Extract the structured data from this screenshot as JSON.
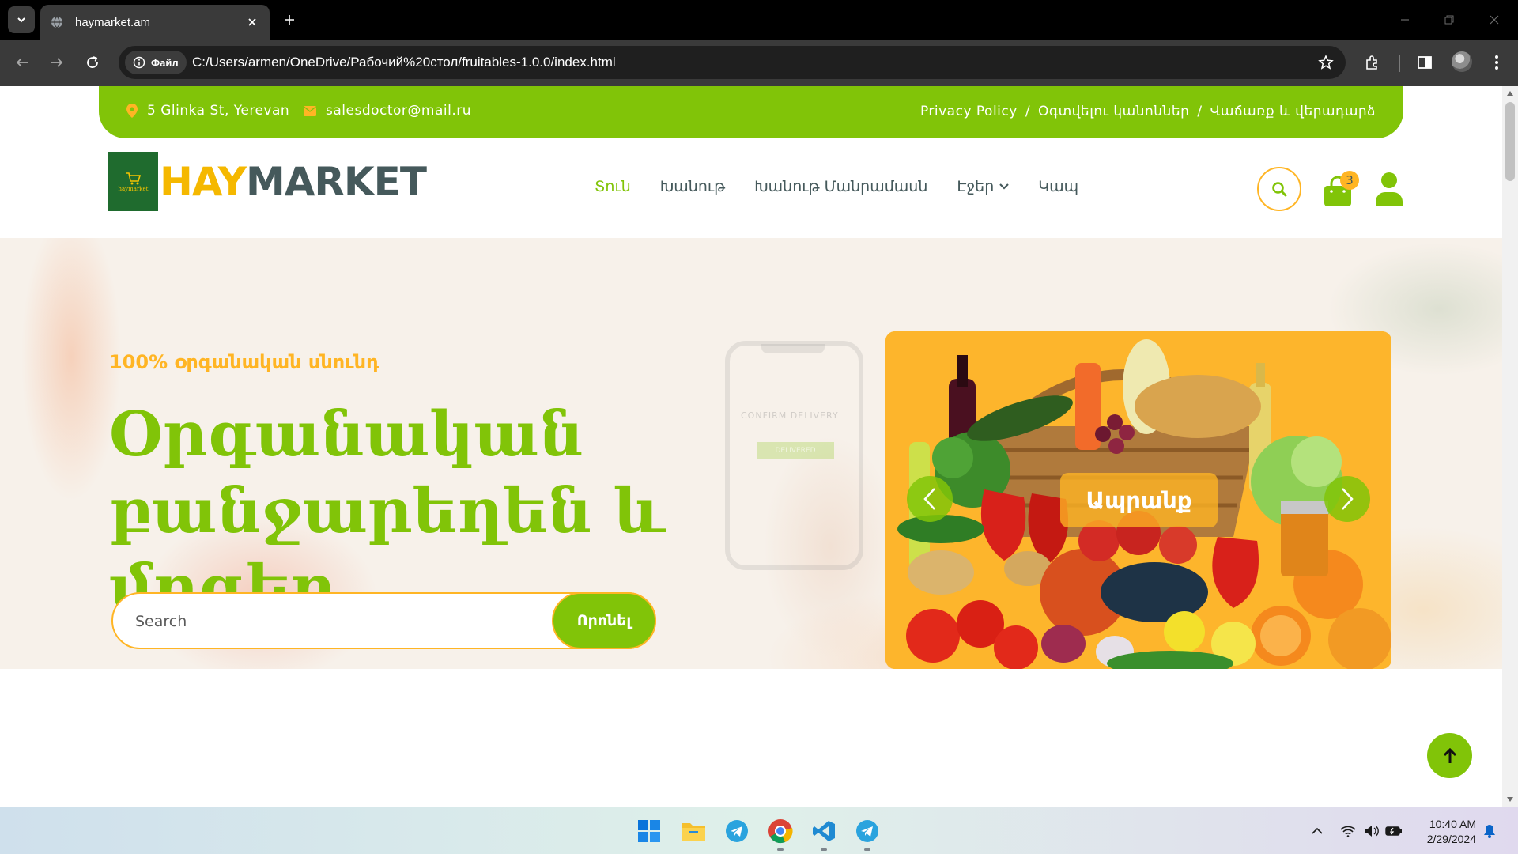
{
  "browser": {
    "tab_title": "haymarket.am",
    "site_chip_label": "Файл",
    "url": "C:/Users/armen/OneDrive/Рабочий%20стол/fruitables-1.0.0/index.html"
  },
  "topbar": {
    "address": "5 Glinka St, Yerevan",
    "email": "salesdoctor@mail.ru",
    "links": [
      "Privacy Policy",
      "Օգտվելու կանոններ",
      "Վաճառք և վերադարձ"
    ],
    "separator": "/"
  },
  "brand": {
    "part1": "HAY",
    "part2": "MARKET",
    "logo_text": "haymarket",
    "colors": {
      "hay": "#f5b800",
      "market": "#45595b",
      "logo_bg": "#1f6b2e"
    }
  },
  "nav": {
    "items": [
      {
        "label": "Տուն",
        "active": true
      },
      {
        "label": "Խանութ",
        "active": false
      },
      {
        "label": "Խանութ Մանրամասն",
        "active": false
      },
      {
        "label": "Էջեր",
        "active": false,
        "dropdown": true
      },
      {
        "label": "Կապ",
        "active": false
      }
    ],
    "cart_count": "3"
  },
  "hero": {
    "subtitle": "100% օրգանական սնունդ",
    "title": "Օրգանական բանջարեղեն և մրգեր",
    "search_placeholder": "Search",
    "search_button": "Որոնել",
    "background_phone_text": "CONFIRM DELIVERY",
    "background_phone_button": "DELIVERED",
    "carousel_caption": "Ապրանք"
  },
  "taskbar": {
    "time": "10:40 AM",
    "date": "2/29/2024",
    "apps": [
      "start-icon",
      "file-explorer-icon",
      "telegram-icon",
      "chrome-icon",
      "vscode-icon",
      "telegram-icon"
    ]
  },
  "colors": {
    "primary": "#81c408",
    "secondary": "#ffb524",
    "dark": "#45595b",
    "browser_bg": "#000000",
    "toolbar_bg": "#3a3a3a"
  }
}
